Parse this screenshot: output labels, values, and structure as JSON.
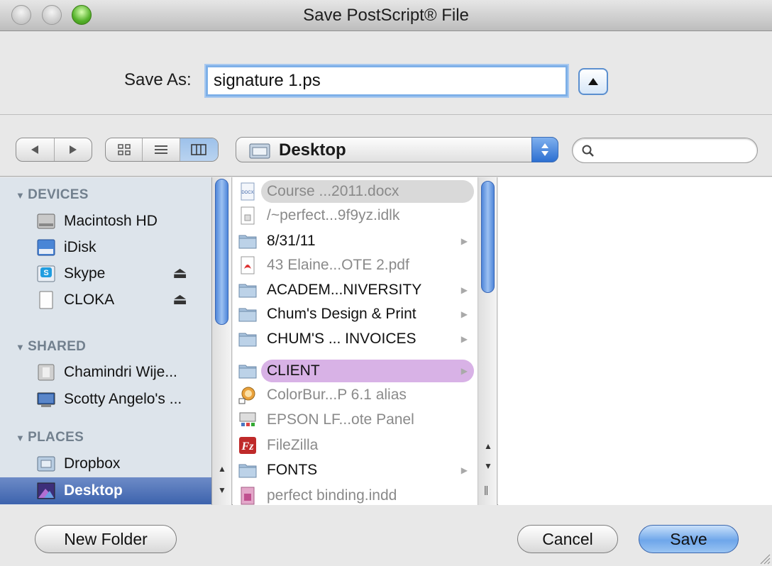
{
  "window": {
    "title": "Save PostScript® File"
  },
  "saveas": {
    "label": "Save As:",
    "value": "signature 1.ps"
  },
  "toolbar": {
    "location": "Desktop",
    "search_placeholder": ""
  },
  "sidebar": {
    "sections": [
      {
        "label": "DEVICES",
        "items": [
          {
            "label": "Macintosh HD",
            "icon": "hard-drive-icon"
          },
          {
            "label": "iDisk",
            "icon": "idisk-icon"
          },
          {
            "label": "Skype",
            "icon": "skype-disk-icon",
            "eject": true
          },
          {
            "label": "CLOKA",
            "icon": "external-disk-icon",
            "eject": true
          }
        ]
      },
      {
        "label": "SHARED",
        "items": [
          {
            "label": "Chamindri Wije...",
            "icon": "shared-computer-icon"
          },
          {
            "label": "Scotty Angelo's ...",
            "icon": "shared-display-icon"
          }
        ]
      },
      {
        "label": "PLACES",
        "items": [
          {
            "label": "Dropbox",
            "icon": "dropbox-folder-icon"
          },
          {
            "label": "Desktop",
            "icon": "desktop-icon",
            "selected": true
          }
        ]
      }
    ]
  },
  "files": [
    {
      "name": "Course ...2011.docx",
      "kind": "docx",
      "dim": true,
      "highlight": "gray"
    },
    {
      "name": "/~perfect...9f9yz.idlk",
      "kind": "doc",
      "dim": true
    },
    {
      "name": "8/31/11",
      "kind": "folder",
      "arrow": true
    },
    {
      "name": "43 Elaine...OTE 2.pdf",
      "kind": "pdf",
      "dim": true
    },
    {
      "name": "ACADEM...NIVERSITY",
      "kind": "folder",
      "arrow": true
    },
    {
      "name": "Chum's Design & Print",
      "kind": "folder",
      "arrow": true
    },
    {
      "name": "CHUM'S ... INVOICES",
      "kind": "folder",
      "arrow": true
    },
    {
      "name": "CLIENT",
      "kind": "folder",
      "arrow": true,
      "highlight": "purple"
    },
    {
      "name": "ColorBur...P 6.1 alias",
      "kind": "alias",
      "dim": true
    },
    {
      "name": "EPSON LF...ote Panel",
      "kind": "app",
      "dim": true
    },
    {
      "name": "FileZilla",
      "kind": "filezilla",
      "dim": true
    },
    {
      "name": "FONTS",
      "kind": "folder",
      "arrow": true
    },
    {
      "name": "perfect binding.indd",
      "kind": "indd",
      "dim": true
    }
  ],
  "buttons": {
    "new_folder": "New Folder",
    "cancel": "Cancel",
    "save": "Save"
  },
  "colors": {
    "accent": "#5b8fcf",
    "sidebar_bg": "#dde4eb",
    "selection": "#3d63ad",
    "label_highlight": "#d8b2e6"
  }
}
